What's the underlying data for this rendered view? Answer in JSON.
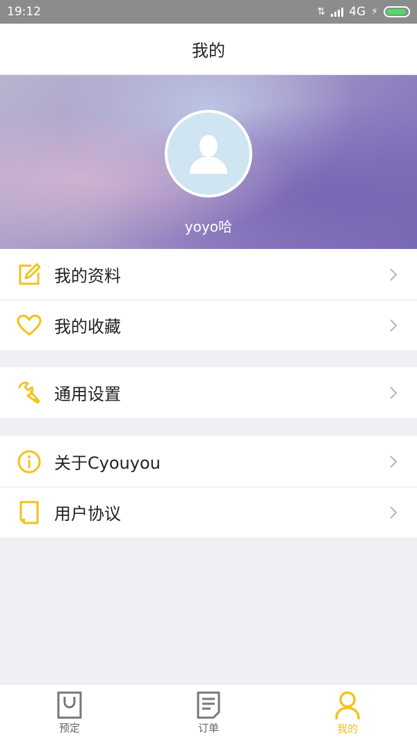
{
  "status_bar": {
    "time": "19:12",
    "network": "4G"
  },
  "header": {
    "title": "我的"
  },
  "profile": {
    "username": "yoyo哈"
  },
  "menu_groups": [
    [
      {
        "label": "我的资料",
        "icon": "edit-icon"
      },
      {
        "label": "我的收藏",
        "icon": "heart-icon"
      }
    ],
    [
      {
        "label": "通用设置",
        "icon": "wrench-icon"
      }
    ],
    [
      {
        "label": "关于Cyouyou",
        "icon": "info-icon"
      },
      {
        "label": "用户协议",
        "icon": "document-icon"
      }
    ]
  ],
  "tab_bar": {
    "tabs": [
      {
        "label": "预定",
        "icon": "shopping-bag-icon",
        "active": false
      },
      {
        "label": "订单",
        "icon": "list-document-icon",
        "active": false
      },
      {
        "label": "我的",
        "icon": "user-icon",
        "active": true
      }
    ]
  },
  "colors": {
    "accent": "#f3c21b",
    "background": "#efeff4",
    "status_bar": "#8c8c8c"
  }
}
